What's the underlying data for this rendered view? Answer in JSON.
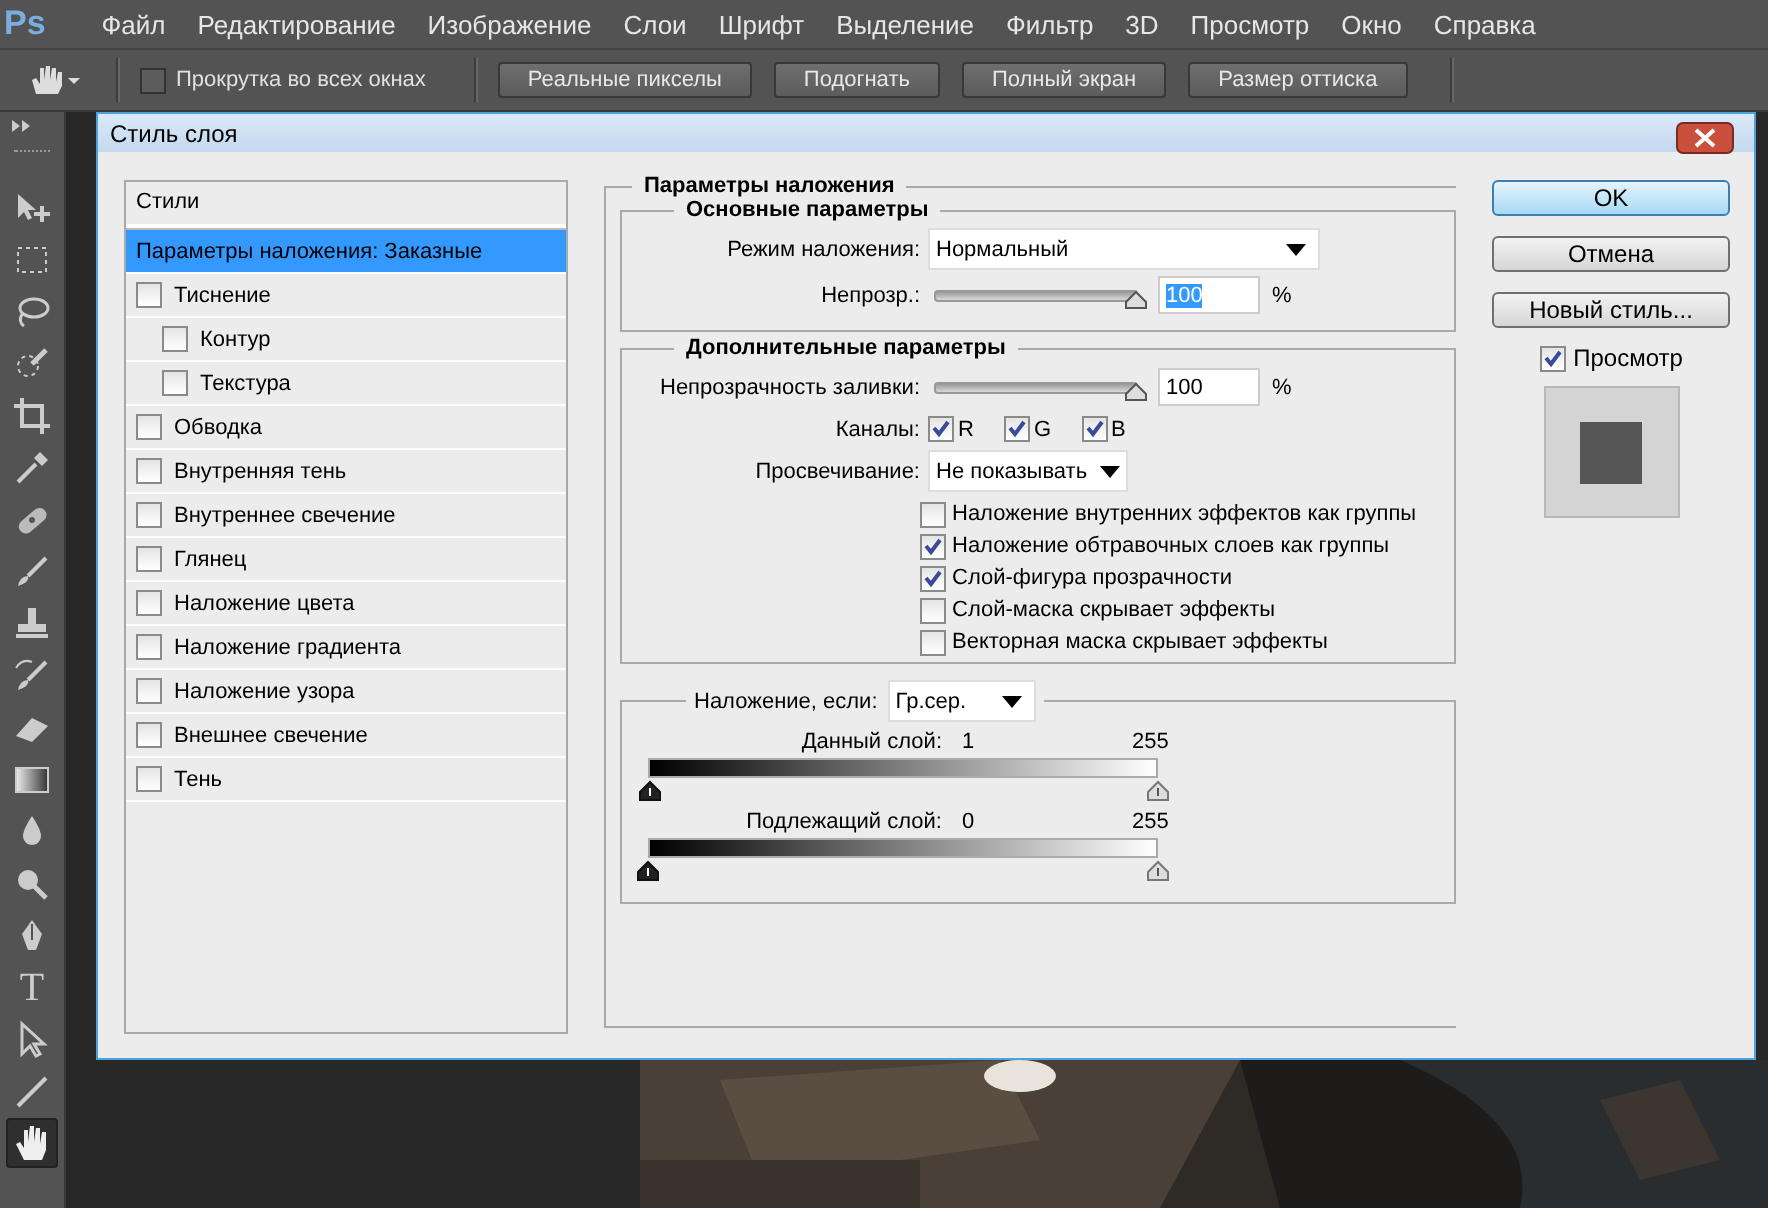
{
  "app_logo": "Ps",
  "menu": [
    "Файл",
    "Редактирование",
    "Изображение",
    "Слои",
    "Шрифт",
    "Выделение",
    "Фильтр",
    "3D",
    "Просмотр",
    "Окно",
    "Справка"
  ],
  "options_bar": {
    "scroll_all": {
      "label": "Прокрутка во всех окнах",
      "checked": false
    },
    "buttons": [
      "Реальные пикселы",
      "Подогнать",
      "Полный экран",
      "Размер оттиска"
    ]
  },
  "tools": [
    {
      "kind": "move",
      "selected": false
    },
    {
      "kind": "marquee",
      "selected": false
    },
    {
      "kind": "lasso",
      "selected": false
    },
    {
      "kind": "quick-select",
      "selected": false
    },
    {
      "kind": "crop",
      "selected": false
    },
    {
      "kind": "eyedropper",
      "selected": false
    },
    {
      "kind": "healing",
      "selected": false
    },
    {
      "kind": "brush",
      "selected": false
    },
    {
      "kind": "stamp",
      "selected": false
    },
    {
      "kind": "history-brush",
      "selected": false
    },
    {
      "kind": "eraser",
      "selected": false
    },
    {
      "kind": "gradient",
      "selected": false
    },
    {
      "kind": "blur",
      "selected": false
    },
    {
      "kind": "dodge",
      "selected": false
    },
    {
      "kind": "pen",
      "selected": false
    },
    {
      "kind": "type",
      "label": "T",
      "selected": false
    },
    {
      "kind": "path-select",
      "selected": false
    },
    {
      "kind": "line",
      "selected": false
    },
    {
      "kind": "hand",
      "selected": true
    }
  ],
  "dialog": {
    "title": "Стиль слоя",
    "styles": {
      "header": "Стили",
      "items": [
        {
          "kind": "section",
          "label": "Параметры наложения: Заказные",
          "selected": true
        },
        {
          "kind": "effect",
          "label": "Тиснение",
          "checked": false,
          "selected": false,
          "children": [
            {
              "kind": "effect",
              "label": "Контур",
              "checked": false,
              "selected": false
            },
            {
              "kind": "effect",
              "label": "Текстура",
              "checked": false,
              "selected": false
            }
          ]
        },
        {
          "kind": "effect",
          "label": "Обводка",
          "checked": false,
          "selected": false
        },
        {
          "kind": "effect",
          "label": "Внутренняя тень",
          "checked": false,
          "selected": false
        },
        {
          "kind": "effect",
          "label": "Внутреннее свечение",
          "checked": false,
          "selected": false
        },
        {
          "kind": "effect",
          "label": "Глянец",
          "checked": false,
          "selected": false
        },
        {
          "kind": "effect",
          "label": "Наложение цвета",
          "checked": false,
          "selected": false
        },
        {
          "kind": "effect",
          "label": "Наложение градиента",
          "checked": false,
          "selected": false
        },
        {
          "kind": "effect",
          "label": "Наложение узора",
          "checked": false,
          "selected": false
        },
        {
          "kind": "effect",
          "label": "Внешнее свечение",
          "checked": false,
          "selected": false
        },
        {
          "kind": "effect",
          "label": "Тень",
          "checked": false,
          "selected": false
        }
      ]
    },
    "blending": {
      "title": "Параметры наложения",
      "general": {
        "title": "Основные параметры",
        "blend_mode": {
          "label": "Режим наложения:",
          "value": "Нормальный"
        },
        "opacity": {
          "label": "Непрозр.:",
          "level": 1,
          "value": "100",
          "unit": "%",
          "selected": true
        }
      },
      "advanced": {
        "title": "Дополнительные параметры",
        "fill_opacity": {
          "label": "Непрозрачность заливки:",
          "level": 1,
          "value": "100",
          "unit": "%",
          "selected": false
        },
        "channels": {
          "label": "Каналы:",
          "items": [
            {
              "label": "R",
              "checked": true
            },
            {
              "label": "G",
              "checked": true
            },
            {
              "label": "B",
              "checked": true
            }
          ]
        },
        "knockout": {
          "label": "Просвечивание:",
          "value": "Не показывать"
        },
        "options": [
          {
            "label": "Наложение внутренних эффектов как группы",
            "checked": false
          },
          {
            "label": "Наложение обтравочных слоев как группы",
            "checked": true
          },
          {
            "label": "Слой-фигура прозрачности",
            "checked": true
          },
          {
            "label": "Слой-маска скрывает эффекты",
            "checked": false
          },
          {
            "label": "Векторная маска скрывает эффекты",
            "checked": false
          }
        ]
      },
      "blend_if": {
        "label": "Наложение, если:",
        "value": "Гр.сер.",
        "ranges": [
          {
            "label": "Данный слой:",
            "low": "1",
            "high": "255"
          },
          {
            "label": "Подлежащий слой:",
            "low": "0",
            "high": "255"
          }
        ]
      }
    },
    "buttons": [
      {
        "label": "OK",
        "default": true
      },
      {
        "label": "Отмена",
        "default": false
      },
      {
        "label": "Новый стиль...",
        "default": false
      }
    ],
    "preview": {
      "label": "Просмотр",
      "checked": true
    }
  }
}
